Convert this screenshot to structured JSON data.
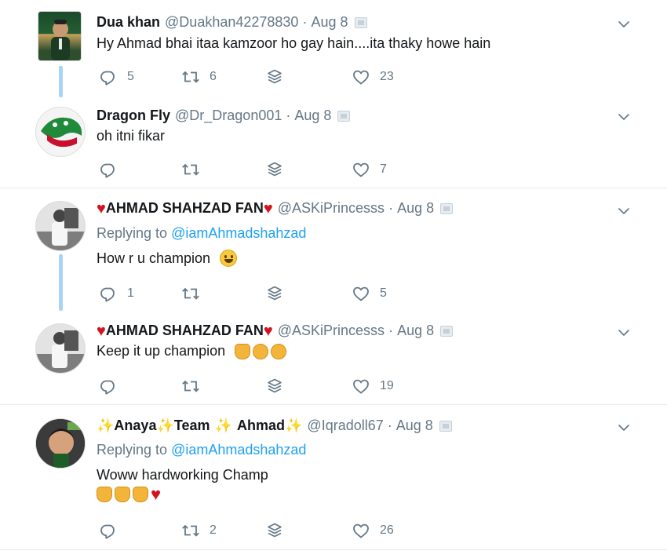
{
  "tweets": [
    {
      "name": "Dua khan",
      "handle": "@Duakhan42278830",
      "date": "Aug 8",
      "text": "Hy Ahmad bhai itaa kamzoor ho gay hain....ita thaky howe hain",
      "replies": "5",
      "retweets": "6",
      "likes": "23"
    },
    {
      "name": "Dragon Fly",
      "handle": "@Dr_Dragon001",
      "date": "Aug 8",
      "text": "oh itni fikar",
      "replies": "",
      "retweets": "",
      "likes": "7"
    },
    {
      "name": "AHMAD SHAHZAD FAN",
      "handle": "@ASKiPrincesss",
      "date": "Aug 8",
      "replying_label": "Replying to",
      "replying_to": "@iamAhmadshahzad",
      "text": "How r u champion",
      "replies": "1",
      "retweets": "",
      "likes": "5"
    },
    {
      "name": "AHMAD SHAHZAD FAN",
      "handle": "@ASKiPrincesss",
      "date": "Aug 8",
      "text": "Keep it up champion",
      "replies": "",
      "retweets": "",
      "likes": "19"
    },
    {
      "name_parts": [
        "Anaya",
        "Team",
        "Ahmad"
      ],
      "handle": "@Iqradoll67",
      "date": "Aug 8",
      "replying_label": "Replying to",
      "replying_to": "@iamAhmadshahzad",
      "text": "Woww hardworking Champ",
      "replies": "",
      "retweets": "2",
      "likes": "26"
    }
  ],
  "separator": "·",
  "icons": {
    "reply": "reply-icon",
    "retweet": "retweet-icon",
    "dm": "direct-message-icon",
    "like": "heart-icon",
    "menu": "chevron-down-icon"
  },
  "colors": {
    "link": "#1da1f2",
    "muted": "#657786",
    "thread": "#a8d4f5",
    "heart_emoji": "#d3131e"
  }
}
